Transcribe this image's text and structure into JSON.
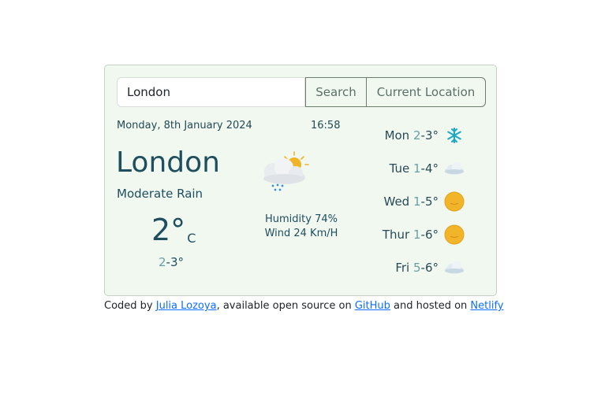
{
  "search": {
    "value": "London",
    "search_label": "Search",
    "location_label": "Current Location"
  },
  "current": {
    "date": "Monday, 8th January 2024",
    "time": "16:58",
    "city": "London",
    "description": "Moderate Rain",
    "temperature": "2°",
    "unit": "C",
    "min": "2",
    "max": "-3°",
    "humidity": "Humidity 74%",
    "wind": "Wind 24 Km/H",
    "icon": "cloud-sun-rain-icon"
  },
  "forecast": [
    {
      "day": "Mon",
      "min": "2",
      "max": "-3°",
      "icon": "snowflake-icon"
    },
    {
      "day": "Tue",
      "min": "1",
      "max": "-4°",
      "icon": "cloud-icon"
    },
    {
      "day": "Wed",
      "min": "1",
      "max": "-5°",
      "icon": "sun-icon"
    },
    {
      "day": "Thur",
      "min": "1",
      "max": "-6°",
      "icon": "sun-icon"
    },
    {
      "day": "Fri",
      "min": "5",
      "max": "-6°",
      "icon": "cloud-icon"
    }
  ],
  "footer": {
    "prefix": "Coded by ",
    "author": "Julia Lozoya",
    "middle": ", available open source on ",
    "github": "GitHub",
    "and_hosted": " and hosted on ",
    "netlify": "Netlify"
  },
  "colors": {
    "card_background": "#f0f8f0",
    "text_primary": "#1f4e5f",
    "text_muted": "#6aa0a5",
    "link": "#0d6efd",
    "sun": "#f0b429",
    "snow": "#1ba9c4"
  }
}
